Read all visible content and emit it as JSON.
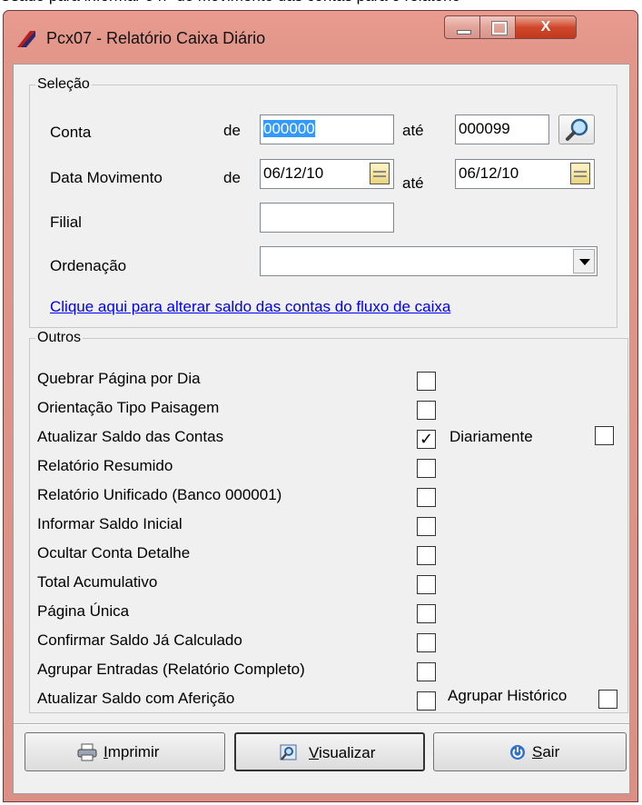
{
  "background_text": "Usado para informar o nº do movimento das contas para o relatório",
  "window": {
    "title": "Pcx07 - Relatório Caixa  Diário",
    "close_glyph": "X"
  },
  "selecao": {
    "group_label": "Seleção",
    "conta": {
      "label": "Conta",
      "de_label": "de",
      "from_value": "000000",
      "ate_label": "até",
      "to_value": "000099"
    },
    "data": {
      "label": "Data Movimento",
      "de_label": "de",
      "from_value": "06/12/10",
      "ate_label": "até",
      "to_value": "06/12/10"
    },
    "filial": {
      "label": "Filial",
      "value": ""
    },
    "ordenacao": {
      "label": "Ordenação",
      "value": ""
    },
    "link_text": "Clique aqui para alterar saldo das contas do fluxo de caixa"
  },
  "outros": {
    "group_label": "Outros",
    "options": [
      {
        "label": "Quebrar Página por Dia",
        "checked": false
      },
      {
        "label": "Orientação Tipo Paisagem",
        "checked": false
      },
      {
        "label": "Atualizar Saldo das Contas",
        "checked": true
      },
      {
        "label": "Relatório Resumido",
        "checked": false
      },
      {
        "label": "Relatório Unificado (Banco 000001)",
        "checked": false
      },
      {
        "label": "Informar Saldo Inicial",
        "checked": false
      },
      {
        "label": "Ocultar Conta Detalhe",
        "checked": false
      },
      {
        "label": "Total Acumulativo",
        "checked": false
      },
      {
        "label": "Página Única",
        "checked": false
      },
      {
        "label": "Confirmar Saldo Já Calculado",
        "checked": false
      },
      {
        "label": "Agrupar Entradas (Relatório Completo)",
        "checked": false
      },
      {
        "label": "Atualizar Saldo com Aferição",
        "checked": false
      }
    ],
    "diariamente": {
      "label": "Diariamente",
      "checked": false
    },
    "agrupar_historico": {
      "label": "Agrupar Histórico",
      "checked": false
    }
  },
  "buttons": {
    "imprimir": {
      "pre": "",
      "accel": "I",
      "post": "mprimir"
    },
    "visualizar": {
      "pre": "",
      "accel": "V",
      "post": "isualizar"
    },
    "sair": {
      "pre": "",
      "accel": "S",
      "post": "air"
    }
  },
  "colors": {
    "title_frame": "#e3968a",
    "selection": "#3399ff",
    "link": "#0000ee",
    "client_bg": "#f0f0f0"
  }
}
